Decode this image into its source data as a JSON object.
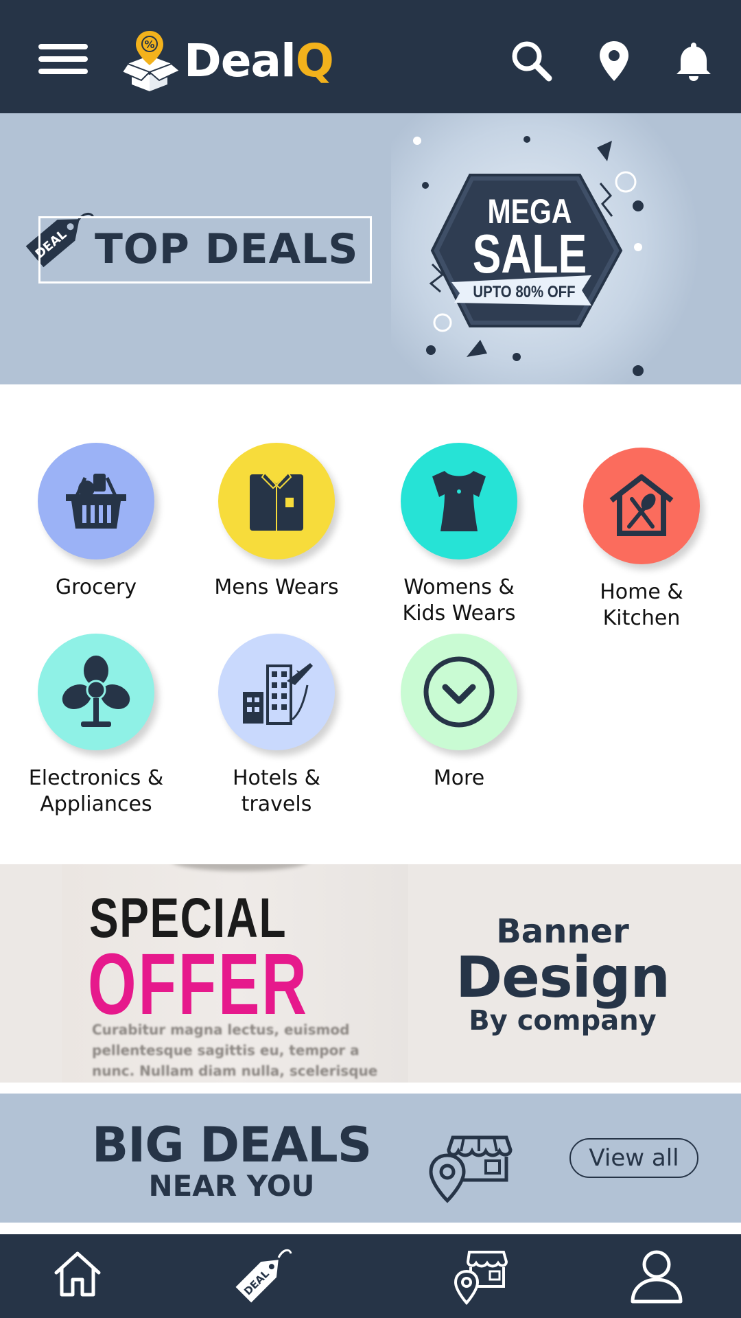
{
  "app": {
    "logo_main": "Deal",
    "logo_accent": "Q"
  },
  "header": {
    "icons": [
      "hamburger-menu-icon",
      "search-icon",
      "location-pin-icon",
      "bell-icon"
    ]
  },
  "top_banner": {
    "title": "TOP DEALS",
    "tag_text": "DEAL",
    "sale_line1": "MEGA",
    "sale_line2": "SALE",
    "sale_ribbon": "UPTO 80% OFF"
  },
  "categories": [
    {
      "label": "Grocery",
      "icon": "grocery-basket-icon",
      "color": "#9bb2f6"
    },
    {
      "label": "Mens Wears",
      "icon": "shirt-icon",
      "color": "#f7dc3b"
    },
    {
      "label": "Womens &\nKids Wears",
      "icon": "blouse-icon",
      "color": "#26e3d6"
    },
    {
      "label": "Home &\nKitchen",
      "icon": "home-kitchen-icon",
      "color": "#fb6c5d"
    },
    {
      "label": "Electronics &\nAppliances",
      "icon": "fan-icon",
      "color": "#8ff1e6"
    },
    {
      "label": "Hotels &\ntravels",
      "icon": "hotel-plane-icon",
      "color": "#c9d9fd"
    },
    {
      "label": "More",
      "icon": "chevron-down-circle-icon",
      "color": "#c9fbd3"
    }
  ],
  "offer_banner": {
    "special": "SPECIAL",
    "offer": "OFFER",
    "body": "Curabitur magna lectus, euismod pellentesque sagittis eu, tempor a nunc. Nullam diam nulla, scelerisque eget hendrerit in.",
    "right_line1": "Banner",
    "right_line2": "Design",
    "right_line3": "By company",
    "accent_color": "#e6198c"
  },
  "big_deals": {
    "title": "BIG DEALS",
    "subtitle": "NEAR YOU",
    "view_all": "View all"
  },
  "bottom_nav": [
    "home-icon",
    "deal-tag-icon",
    "store-location-icon",
    "profile-icon"
  ],
  "colors": {
    "primary": "#263447",
    "accent": "#f3b21c",
    "banner_bg": "#b2c2d5"
  }
}
